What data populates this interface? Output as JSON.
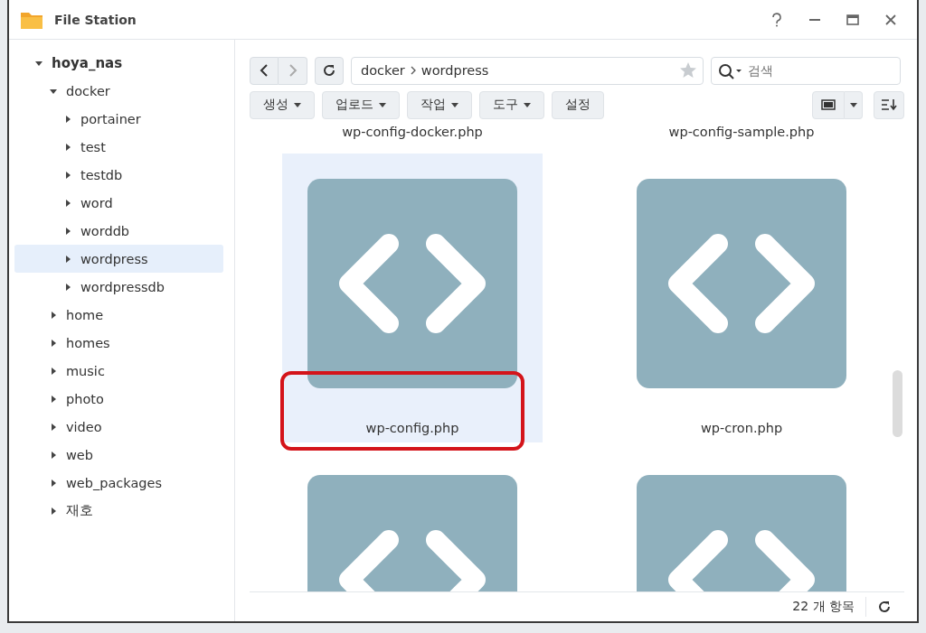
{
  "window": {
    "title": "File Station"
  },
  "sidebar": {
    "tree": [
      {
        "label": "hoya_nas",
        "expanded": true,
        "selected": false,
        "children": [
          {
            "label": "docker",
            "expanded": true,
            "selected": false,
            "children": [
              {
                "label": "portainer",
                "expanded": false,
                "selected": false
              },
              {
                "label": "test",
                "expanded": false,
                "selected": false
              },
              {
                "label": "testdb",
                "expanded": false,
                "selected": false
              },
              {
                "label": "word",
                "expanded": false,
                "selected": false
              },
              {
                "label": "worddb",
                "expanded": false,
                "selected": false
              },
              {
                "label": "wordpress",
                "expanded": false,
                "selected": true
              },
              {
                "label": "wordpressdb",
                "expanded": false,
                "selected": false
              }
            ]
          },
          {
            "label": "home",
            "expanded": false,
            "selected": false
          },
          {
            "label": "homes",
            "expanded": false,
            "selected": false
          },
          {
            "label": "music",
            "expanded": false,
            "selected": false
          },
          {
            "label": "photo",
            "expanded": false,
            "selected": false
          },
          {
            "label": "video",
            "expanded": false,
            "selected": false
          },
          {
            "label": "web",
            "expanded": false,
            "selected": false
          },
          {
            "label": "web_packages",
            "expanded": false,
            "selected": false
          },
          {
            "label": "재호",
            "expanded": false,
            "selected": false
          }
        ]
      }
    ]
  },
  "path": [
    "docker",
    "wordpress"
  ],
  "search": {
    "placeholder": "검색"
  },
  "actions": [
    "생성",
    "업로드",
    "작업",
    "도구"
  ],
  "settings_button": "설정",
  "files": [
    {
      "kind": "label_only",
      "name": "wp-config-docker.php",
      "selected": false,
      "highlighted": false
    },
    {
      "kind": "label_only",
      "name": "wp-config-sample.php",
      "selected": false,
      "highlighted": false
    },
    {
      "kind": "full",
      "name": "wp-config.php",
      "selected": true,
      "highlighted": true
    },
    {
      "kind": "full",
      "name": "wp-cron.php",
      "selected": false,
      "highlighted": false
    },
    {
      "kind": "icon_only",
      "selected": false,
      "highlighted": false
    },
    {
      "kind": "icon_only",
      "selected": false,
      "highlighted": false
    }
  ],
  "status_bar": {
    "count": "22 개 항목"
  }
}
